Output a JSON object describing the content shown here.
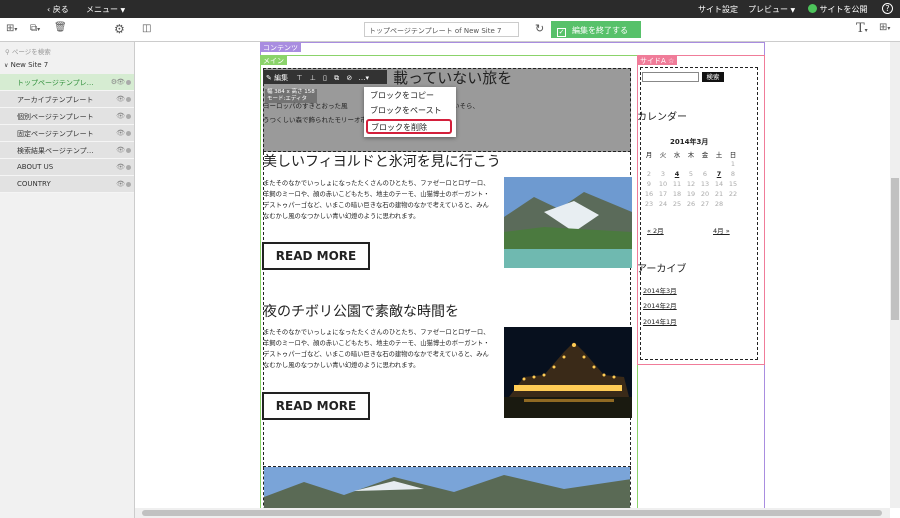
{
  "topbar": {
    "back": "戻る",
    "menu": "メニュー",
    "site_settings": "サイト設定",
    "preview": "プレビュー",
    "publish": "サイトを公開",
    "help_icon": "question-circle-icon"
  },
  "toolbar": {
    "title_field": "トップページテンプレート of New Site 7",
    "finish_button": "編集を終了する",
    "text_icon": "T"
  },
  "sidebar": {
    "search_placeholder": "ページを検索",
    "root": "New Site 7",
    "items": [
      {
        "label": "トップページテンプレ…",
        "selected": true
      },
      {
        "label": "アーカイブテンプレート",
        "selected": false
      },
      {
        "label": "個別ページテンプレート",
        "selected": false
      },
      {
        "label": "固定ページテンプレート",
        "selected": false
      },
      {
        "label": "検索結果ページテンプ…",
        "selected": false
      },
      {
        "label": "ABOUT US",
        "selected": false
      },
      {
        "label": "COUNTRY",
        "selected": false
      }
    ]
  },
  "page": {
    "contents_label": "コンテンツ",
    "main_label": "メイン",
    "side_label": "サイドA",
    "edit_label": "編集",
    "block_size": "幅 384 x 高さ 158",
    "block_mode": "モード:エディタ",
    "hero_title": "載っていない旅を",
    "hero_line1": "ヨーロッパのすきとおった風",
    "hero_line1b": "いそら、",
    "hero_line2": "うつくしい森で飾られたモリーオ市",
    "context_menu": [
      "ブロックをコピー",
      "ブロックをペースト",
      "ブロックを削除"
    ],
    "articles": [
      {
        "title": "美しいフィヨルドと氷河を見に行こう",
        "body": "またそのなかでいっしょになったたくさんのひとたち、ファゼーロとロザーロ、羊飼のミーロや、顔の赤いこどもたち、地主のテーモ、山猫博士のボーガント・デストゥパーゴなど、いまこの暗い巨きな石の建物のなかで考えていると、みんなむかし風のなつかしい青い幻燈のように思われます。",
        "button": "READ MORE"
      },
      {
        "title": "夜のチボリ公園で素敵な時間を",
        "body": "またそのなかでいっしょになったたくさんのひとたち、ファゼーロとロザーロ、羊飼のミーロや、顔の赤いこどもたち、地主のテーモ、山猫博士のボーガント・デストゥパーゴなど、いまこの暗い巨きな石の建物のなかで考えていると、みんなむかし風のなつかしい青い幻燈のように思われます。",
        "button": "READ MORE"
      }
    ],
    "search_button": "検索",
    "calendar_heading": "カレンダー",
    "calendar_month": "2014年3月",
    "weekdays": [
      "月",
      "火",
      "水",
      "木",
      "金",
      "土",
      "日"
    ],
    "weeks": [
      [
        "",
        "",
        "",
        "",
        "",
        "",
        "1"
      ],
      [
        "2",
        "3",
        "4",
        "5",
        "6",
        "7",
        "8"
      ],
      [
        "9",
        "10",
        "11",
        "12",
        "13",
        "14",
        "15"
      ],
      [
        "16",
        "17",
        "18",
        "19",
        "20",
        "21",
        "22"
      ],
      [
        "23",
        "24",
        "25",
        "26",
        "27",
        "28",
        ""
      ]
    ],
    "weeks_fixed": [
      [
        "",
        "",
        "",
        "",
        "",
        "",
        "1"
      ],
      [
        "3",
        "4",
        "5",
        "6",
        "7",
        "8",
        "9"
      ],
      [
        "10",
        "11",
        "12",
        "13",
        "14",
        "15",
        "16"
      ],
      [
        "17",
        "18",
        "19",
        "20",
        "21",
        "22",
        "23"
      ],
      [
        "24",
        "25",
        "26",
        "27",
        "28",
        "",
        ""
      ]
    ],
    "prev_month": "« 2月",
    "next_month": "4月 »",
    "archive_heading": "アーカイブ",
    "archives": [
      "2014年3月",
      "2014年2月",
      "2014年1月"
    ]
  },
  "colors": {
    "green": "#57c16a",
    "purple": "#a98de0",
    "pink": "#f07c99",
    "topbar": "#2b2b2b"
  }
}
